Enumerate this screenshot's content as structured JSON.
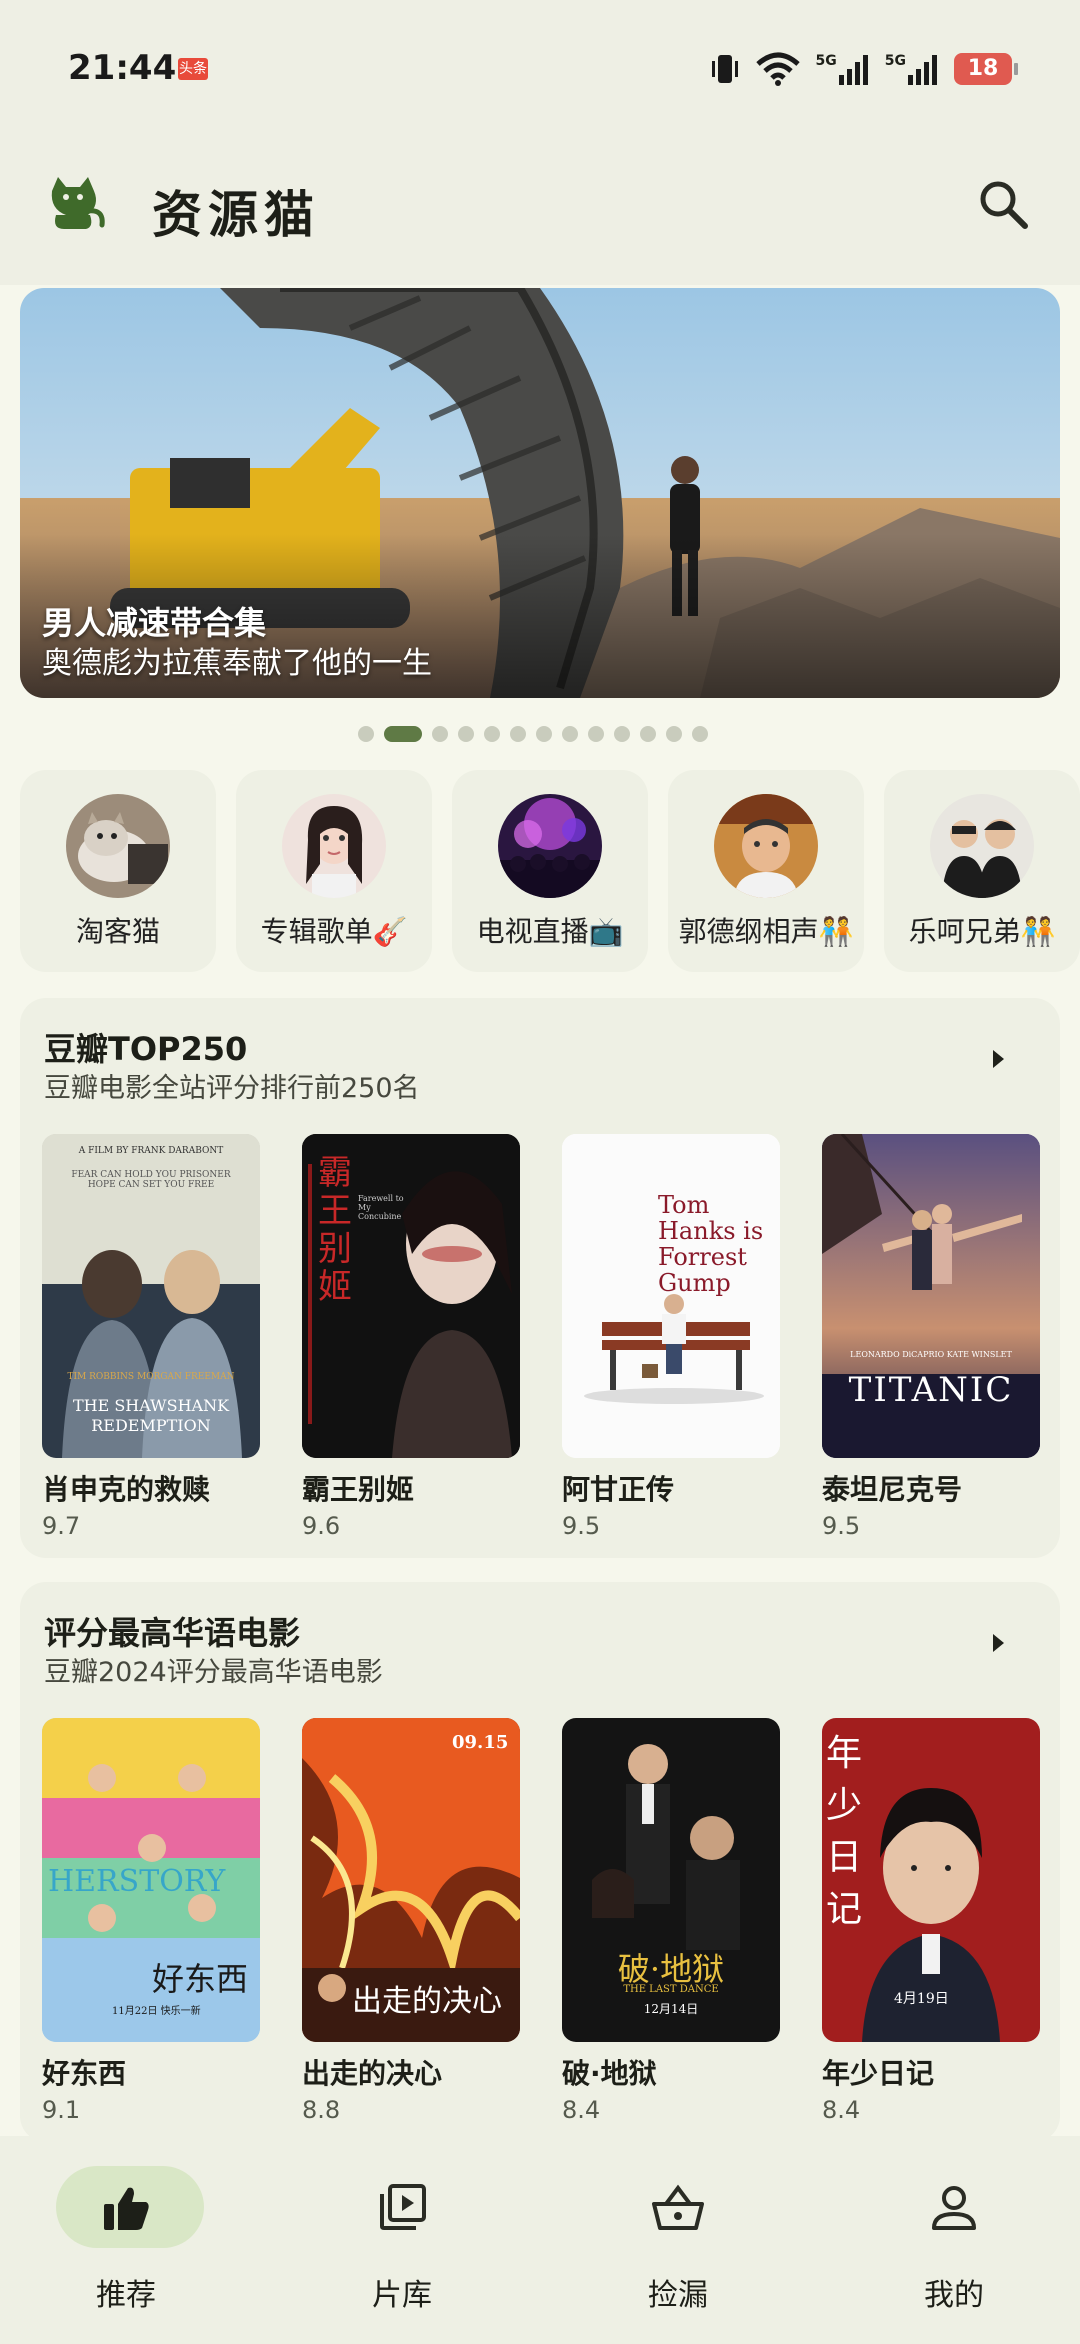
{
  "status_bar": {
    "time": "21:44",
    "news_badge": "头条",
    "network_labels": [
      "5G",
      "5G"
    ],
    "battery": "18",
    "icons": [
      "vibrate-icon",
      "wifi-icon",
      "signal-icon",
      "signal-icon",
      "battery-icon"
    ]
  },
  "app_bar": {
    "title": "资源猫",
    "logo": "cat-logo",
    "search_icon": "search-icon"
  },
  "banner": {
    "title": "男人减速带合集",
    "subtitle": "奥德彪为拉蕉奉献了他的一生",
    "page_count": 13,
    "active_index": 1
  },
  "categories": [
    {
      "label": "淘客猫"
    },
    {
      "label": "专辑歌单🎸"
    },
    {
      "label": "电视直播📺"
    },
    {
      "label": "郭德纲相声🧑‍🤝‍🧑"
    },
    {
      "label": "乐呵兄弟🧑‍🤝‍🧑"
    }
  ],
  "sections": [
    {
      "title": "豆瓣TOP250",
      "subtitle": "豆瓣电影全站评分排行前250名",
      "movies": [
        {
          "name": "肖申克的救赎",
          "score": "9.7",
          "poster_text": "THE SHAWSHANK REDEMPTION",
          "poster_top": "A FILM BY FRANK DARABONT",
          "poster_tag": "FEAR CAN HOLD YOU PRISONER HOPE CAN SET YOU FREE",
          "actors": "TIM ROBBINS     MORGAN FREEMAN"
        },
        {
          "name": "霸王别姬",
          "score": "9.6",
          "poster_text": "霸王别姬",
          "poster_sub": "Farewell to My Concubine"
        },
        {
          "name": "阿甘正传",
          "score": "9.5",
          "poster_text": "Tom Hanks is Forrest Gump"
        },
        {
          "name": "泰坦尼克号",
          "score": "9.5",
          "poster_text": "TITANIC",
          "actors": "LEONARDO DiCAPRIO     KATE WINSLET"
        }
      ]
    },
    {
      "title": "评分最高华语电影",
      "subtitle": "豆瓣2024评分最高华语电影",
      "movies": [
        {
          "name": "好东西",
          "score": "9.1",
          "poster_text": "好东西",
          "poster_sub": "HERSTORY",
          "poster_date": "11月22日 快乐一新"
        },
        {
          "name": "出走的决心",
          "score": "8.8",
          "poster_text": "出走的决心",
          "poster_date": "09.15"
        },
        {
          "name": "破·地狱",
          "score": "8.4",
          "poster_text": "破·地狱",
          "poster_sub": "THE LAST DANCE",
          "poster_date": "12月14日"
        },
        {
          "name": "年少日记",
          "score": "8.4",
          "poster_text": "年少日记",
          "poster_date": "4月19日"
        }
      ]
    }
  ],
  "bottom_nav": [
    {
      "label": "推荐",
      "icon": "thumbs-up-icon",
      "active": true
    },
    {
      "label": "片库",
      "icon": "video-library-icon",
      "active": false
    },
    {
      "label": "捡漏",
      "icon": "basket-icon",
      "active": false
    },
    {
      "label": "我的",
      "icon": "person-icon",
      "active": false
    }
  ],
  "colors": {
    "background": "#f6f7ec",
    "card": "#eef0e4",
    "accent": "#5f7a45",
    "nav_active": "#d9e7c6"
  }
}
